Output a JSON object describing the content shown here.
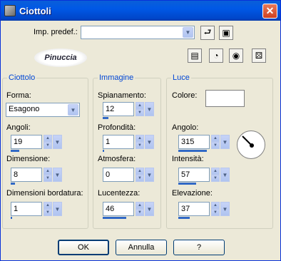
{
  "window": {
    "title": "Ciottoli",
    "close": "✕"
  },
  "preset": {
    "label": "Imp. predef.:",
    "value": ""
  },
  "logo": "Pinuccia",
  "groups": {
    "ciottolo": "Ciottolo",
    "immagine": "Immagine",
    "luce": "Luce"
  },
  "ciottolo": {
    "forma_label": "Forma:",
    "forma_value": "Esagono",
    "angoli_label": "Angoli:",
    "angoli_value": "19",
    "dimensione_label": "Dimensione:",
    "dimensione_value": "8",
    "bordatura_label": "Dimensioni bordatura:",
    "bordatura_value": "1"
  },
  "immagine": {
    "spianamento_label": "Spianamento:",
    "spianamento_value": "12",
    "profondita_label": "Profondità:",
    "profondita_value": "1",
    "atmosfera_label": "Atmosfera:",
    "atmosfera_value": "0",
    "lucentezza_label": "Lucentezza:",
    "lucentezza_value": "46"
  },
  "luce": {
    "colore_label": "Colore:",
    "colore_value": "#ffffff",
    "angolo_label": "Angolo:",
    "angolo_value": "315",
    "intensita_label": "Intensità:",
    "intensita_value": "57",
    "elevazione_label": "Elevazione:",
    "elevazione_value": "37"
  },
  "buttons": {
    "ok": "OK",
    "annulla": "Annulla",
    "help": "?"
  }
}
